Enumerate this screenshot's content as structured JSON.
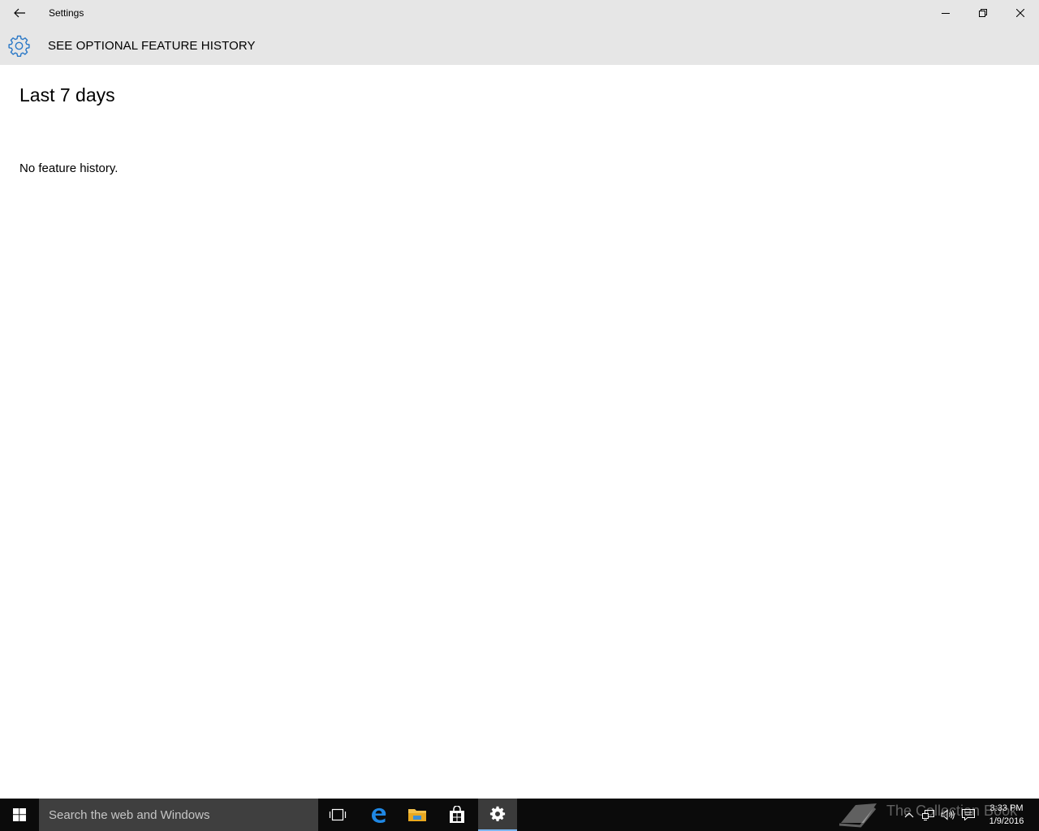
{
  "window": {
    "app_title": "Settings",
    "back_icon": "back-arrow-icon",
    "minimize_icon": "minimize-icon",
    "maximize_icon": "restore-icon",
    "close_icon": "close-icon"
  },
  "header": {
    "icon": "gear-icon",
    "title": "SEE OPTIONAL FEATURE HISTORY",
    "accent_color": "#2a78c7"
  },
  "content": {
    "section_title": "Last 7 days",
    "empty_message": "No feature history."
  },
  "taskbar": {
    "start_icon": "windows-logo-icon",
    "search_placeholder": "Search the web and Windows",
    "apps": [
      {
        "name": "task-view",
        "icon": "task-view-icon",
        "active": false
      },
      {
        "name": "edge",
        "icon": "edge-icon",
        "active": false
      },
      {
        "name": "file-explorer",
        "icon": "folder-icon",
        "active": false
      },
      {
        "name": "store",
        "icon": "store-icon",
        "active": false
      },
      {
        "name": "settings",
        "icon": "gear-icon",
        "active": true
      }
    ],
    "tray": {
      "icons": [
        "chevron-up-icon",
        "network-icon",
        "volume-icon",
        "action-center-icon"
      ],
      "time": "3:33 PM",
      "date": "1/9/2016"
    },
    "watermark_text": "The Collection Book"
  }
}
